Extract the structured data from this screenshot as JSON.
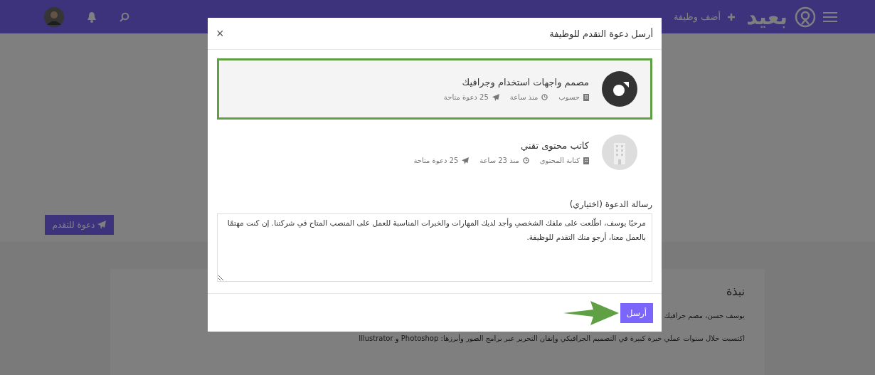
{
  "nav": {
    "logo": "بعيد",
    "add_job": "أضف وظيفة"
  },
  "profile": {
    "invite_button": "دعوة للتقدم",
    "about_title": "نبذة",
    "about_lines": [
      "يوسف حسن، مصم جرافيك",
      "اكتسبت خلال سنوات عملي خبرة كبيرة في التصميم الجرافيكي وإتقان التحرير عبر برامج الصور وأبرزها: Photoshop و Illustrator"
    ]
  },
  "modal": {
    "title": "أرسل دعوة التقدم للوظيفة",
    "close": "×",
    "jobs": [
      {
        "title": "مصمم واجهات استخدام وجرافيك",
        "company": "حسوب",
        "posted": "منذ ساعة",
        "invites": "25 دعوة متاحة",
        "kind": "brand",
        "selected": true
      },
      {
        "title": "كاتب محتوى تقني",
        "company": "كتابة المحتوى",
        "posted": "منذ 23 ساعة",
        "invites": "25 دعوة متاحة",
        "kind": "building",
        "selected": false
      }
    ],
    "message_label": "رسالة الدعوة (اختياري)",
    "message": "مرحبًا يوسف، اطّلعت على ملفك الشخصي وأجد لديك المهارات والخبرات المناسبة للعمل على المنصب المتاح في شركتنا. إن كنت مهتمًا بالعمل معنا، أرجو منك التقدم للوظيفة.",
    "send_button": "أرسل"
  }
}
